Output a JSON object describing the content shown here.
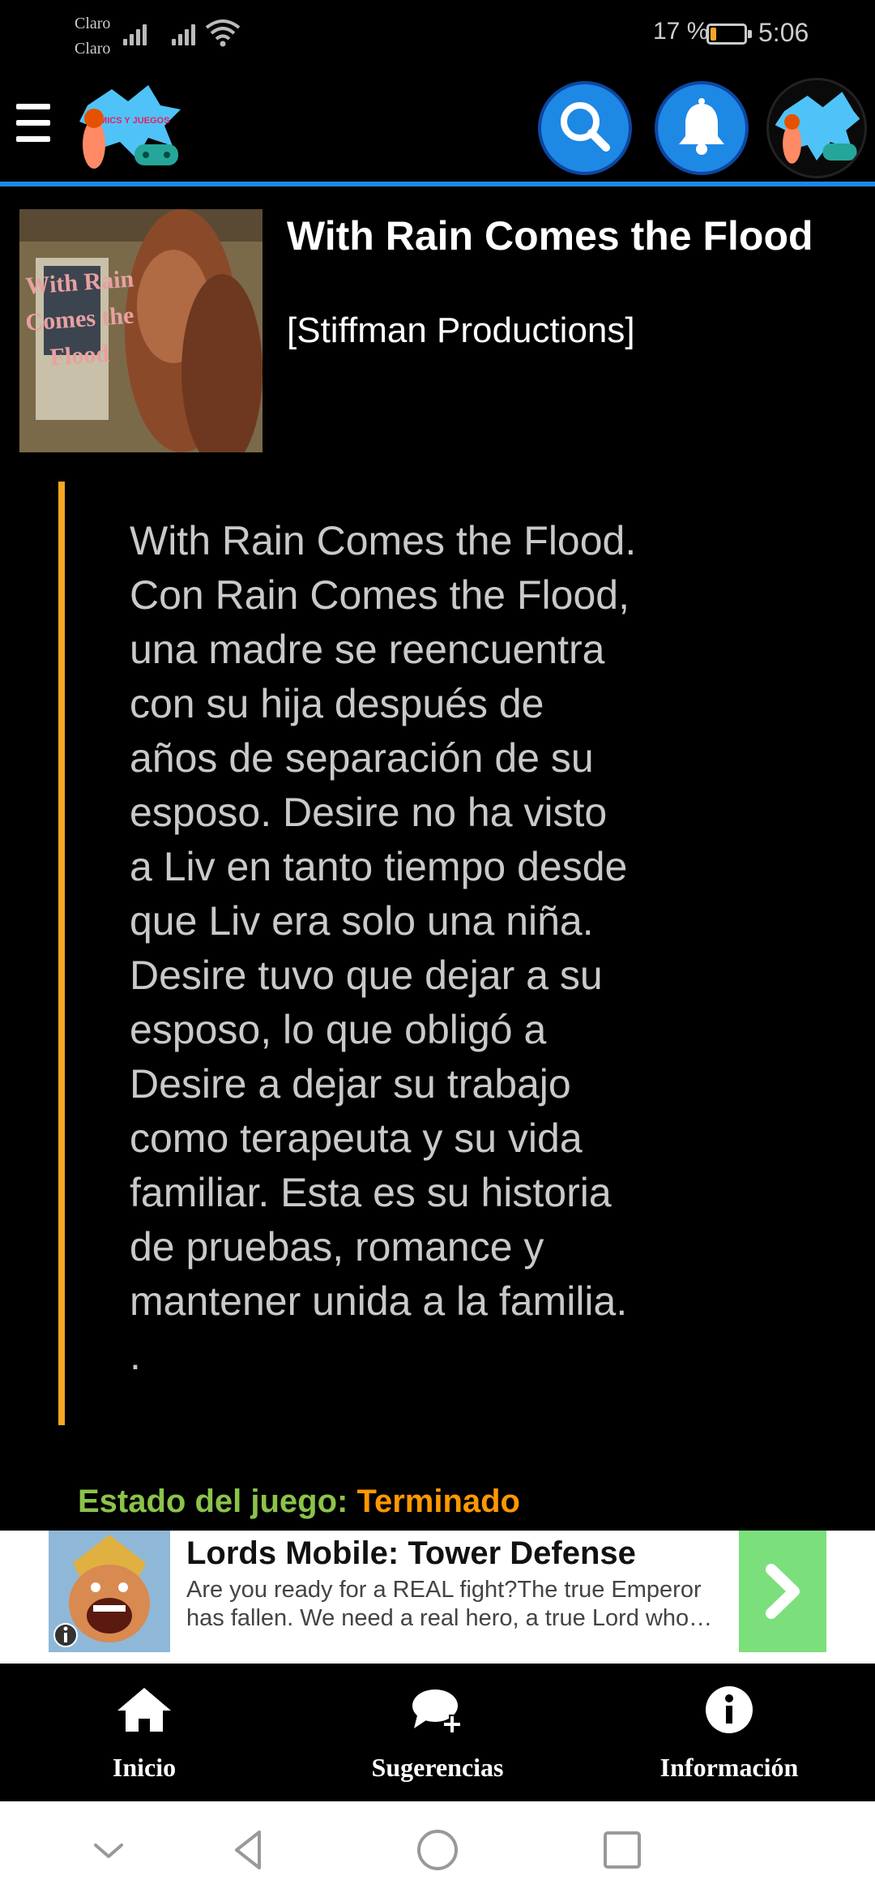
{
  "status_bar": {
    "carrier_1": "Claro",
    "carrier_2": "Claro",
    "battery_percent": "17 %",
    "battery_level": 0.17,
    "battery_color": "#f5a623",
    "time": "5:06"
  },
  "header": {
    "menu_icon": "hamburger-icon",
    "logo_text": "COMICS Y JUEGOS",
    "search_icon": "search-icon",
    "notification_icon": "bell-icon",
    "accent_color": "#1e88e5"
  },
  "game": {
    "cover_text": "With Rain Comes the Flood",
    "title": "With Rain Comes the Flood",
    "developer": "[Stiffman Productions]",
    "description": "With Rain Comes the Flood.\nCon Rain Comes the Flood,\nuna madre se reencuentra\ncon su hija después de\naños de separación de su\nesposo. Desire no ha visto\na Liv en tanto tiempo desde\nque Liv era solo una niña.\nDesire tuvo que dejar a su\nesposo, lo que obligó a\nDesire a dejar su trabajo\ncomo terapeuta y su vida\nfamiliar. Esta es su historia\nde pruebas, romance y\nmantener unida a la familia.\n.",
    "status_label": "Estado del juego:",
    "status_value": "Terminado"
  },
  "ad": {
    "title": "Lords Mobile: Tower Defense",
    "body": "Are you ready for a REAL fight?The true Emperor has fallen. We need a real hero, a true Lord who…",
    "info_icon": "info-icon",
    "cta_icon": "chevron-right-icon"
  },
  "bottom_nav": {
    "items": [
      {
        "label": "Inicio",
        "icon": "home-icon"
      },
      {
        "label": "Sugerencias",
        "icon": "chat-add-icon"
      },
      {
        "label": "Información",
        "icon": "info-icon"
      }
    ]
  },
  "system_nav": {
    "icons": [
      "chevron-down-icon",
      "back-icon",
      "home-circle-icon",
      "recents-icon"
    ]
  }
}
